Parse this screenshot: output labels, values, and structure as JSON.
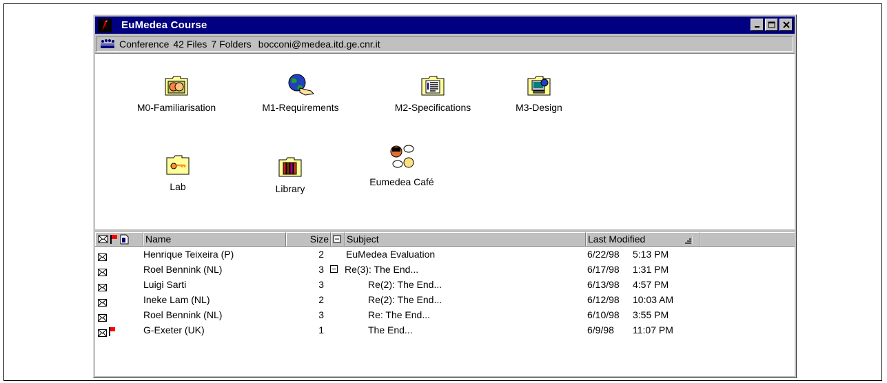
{
  "window": {
    "title": "EuMedea Course",
    "controls": [
      "minimize",
      "maximize",
      "close"
    ]
  },
  "infobar": {
    "section": "Conference",
    "files": "42 Files",
    "folders": "7 Folders",
    "email": "bocconi@medea.itd.ge.cnr.it"
  },
  "icons": [
    {
      "label": "M0-Familiarisation",
      "icon": "folder-faces-icon"
    },
    {
      "label": "M1-Requirements",
      "icon": "globe-hand-icon"
    },
    {
      "label": "M2-Specifications",
      "icon": "folder-document-icon"
    },
    {
      "label": "M3-Design",
      "icon": "folder-computer-icon"
    },
    {
      "label": "Lab",
      "icon": "folder-key-icon"
    },
    {
      "label": "Library",
      "icon": "folder-books-icon"
    },
    {
      "label": "Eumedea Café",
      "icon": "chat-people-icon"
    }
  ],
  "list": {
    "columns": {
      "name": "Name",
      "size": "Size",
      "subject": "Subject",
      "modified": "Last Modified"
    },
    "rows": [
      {
        "name": "Henrique Teixeira (P)",
        "size": "2",
        "subject": "EuMedea Evaluation",
        "date": "6/22/98",
        "time": "5:13 PM",
        "flag": false,
        "collapse": false,
        "indent": 0
      },
      {
        "name": "Roel Bennink (NL)",
        "size": "3",
        "subject": "Re(3): The End...",
        "date": "6/17/98",
        "time": "1:31 PM",
        "flag": false,
        "collapse": true,
        "indent": 0
      },
      {
        "name": "Luigi Sarti",
        "size": "3",
        "subject": "Re(2): The End...",
        "date": "6/13/98",
        "time": "4:57 PM",
        "flag": false,
        "collapse": false,
        "indent": 1
      },
      {
        "name": "Ineke Lam (NL)",
        "size": "2",
        "subject": "Re(2): The End...",
        "date": "6/12/98",
        "time": "10:03 AM",
        "flag": false,
        "collapse": false,
        "indent": 1
      },
      {
        "name": "Roel Bennink (NL)",
        "size": "3",
        "subject": "Re: The End...",
        "date": "6/10/98",
        "time": "3:55 PM",
        "flag": false,
        "collapse": false,
        "indent": 1
      },
      {
        "name": "G-Exeter (UK)",
        "size": "1",
        "subject": "The End...",
        "date": "6/9/98",
        "time": "11:07 PM",
        "flag": true,
        "collapse": false,
        "indent": 1
      }
    ]
  },
  "colors": {
    "titlebar": "#000080",
    "chrome": "#c0c0c0",
    "flag": "#ff0000",
    "folder": "#ffff99"
  }
}
